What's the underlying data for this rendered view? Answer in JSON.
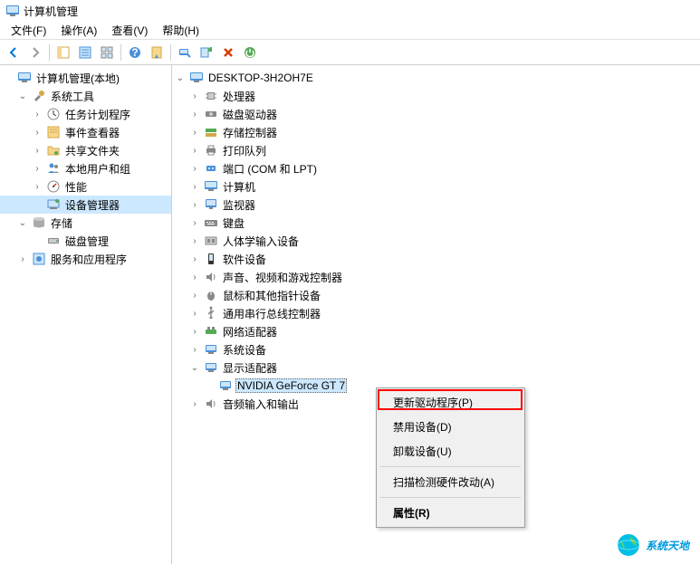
{
  "window": {
    "title": "计算机管理"
  },
  "menubar": {
    "file": "文件(F)",
    "action": "操作(A)",
    "view": "查看(V)",
    "help": "帮助(H)"
  },
  "left_tree": {
    "root": "计算机管理(本地)",
    "system_tools": "系统工具",
    "task_scheduler": "任务计划程序",
    "event_viewer": "事件查看器",
    "shared_folders": "共享文件夹",
    "local_users": "本地用户和组",
    "performance": "性能",
    "device_manager": "设备管理器",
    "storage": "存储",
    "disk_management": "磁盘管理",
    "services_apps": "服务和应用程序"
  },
  "right_tree": {
    "computer": "DESKTOP-3H2OH7E",
    "processors": "处理器",
    "disk_drives": "磁盘驱动器",
    "storage_controllers": "存储控制器",
    "print_queues": "打印队列",
    "ports": "端口 (COM 和 LPT)",
    "computers": "计算机",
    "monitors": "监视器",
    "keyboards": "键盘",
    "hid": "人体学输入设备",
    "software_devices": "软件设备",
    "sound": "声音、视频和游戏控制器",
    "mice": "鼠标和其他指针设备",
    "usb": "通用串行总线控制器",
    "network": "网络适配器",
    "system_devices": "系统设备",
    "display_adapters": "显示适配器",
    "gpu": "NVIDIA GeForce GT 7",
    "audio": "音频输入和输出"
  },
  "context_menu": {
    "update_driver": "更新驱动程序(P)",
    "disable_device": "禁用设备(D)",
    "uninstall_device": "卸载设备(U)",
    "scan_hardware": "扫描检测硬件改动(A)",
    "properties": "属性(R)"
  },
  "watermark": {
    "text": "系统天地"
  }
}
